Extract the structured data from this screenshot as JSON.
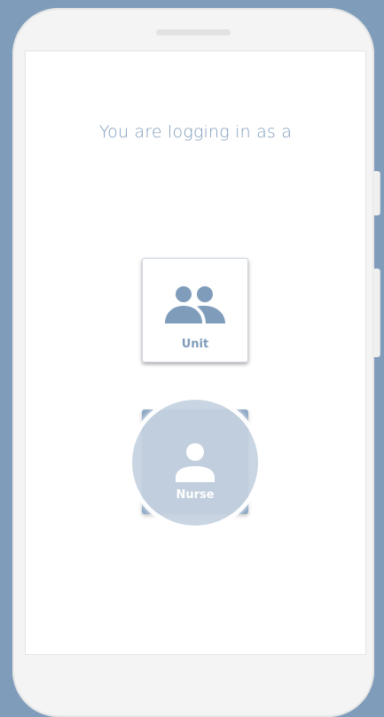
{
  "colors": {
    "background": "#7f9cbb",
    "accent": "#7f9cbb",
    "nurse_card": "#8fa9c6",
    "phone_frame": "#f4f4f4"
  },
  "screen": {
    "heading": "You are logging in as a"
  },
  "roles": [
    {
      "label": "Unit",
      "icon": "group-icon",
      "state": "default"
    },
    {
      "label": "Nurse",
      "icon": "person-icon",
      "state": "pressed"
    }
  ]
}
